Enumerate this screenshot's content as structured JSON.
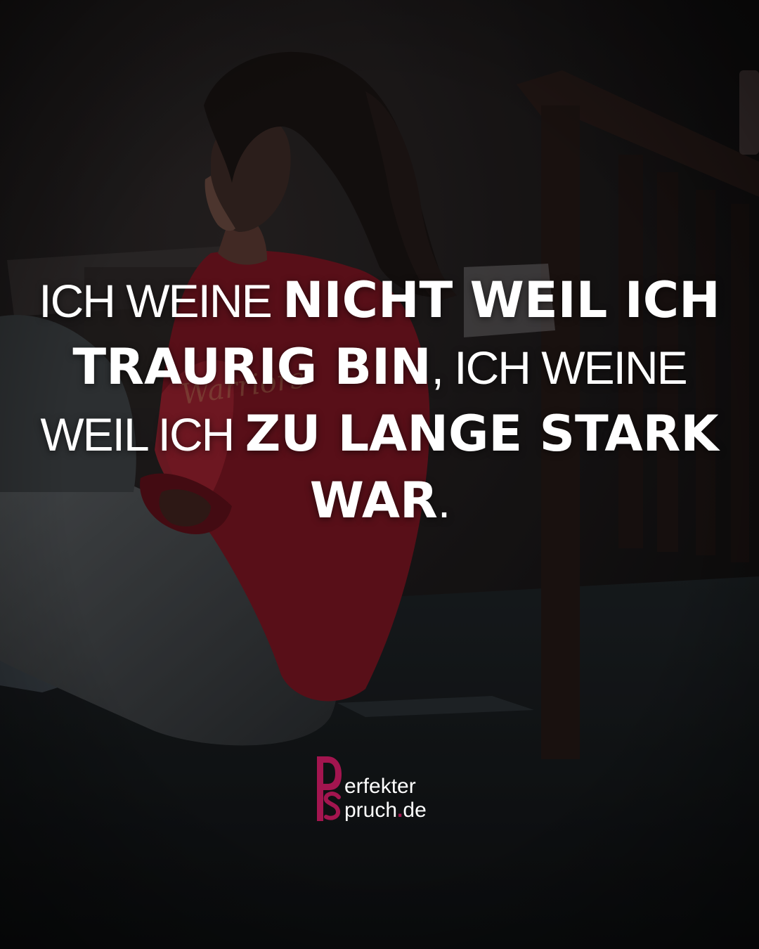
{
  "quote": {
    "line1_thin": "ICH WEINE ",
    "line1_bold": "NICHT WEIL ICH",
    "line2_bold": "TRAURIG BIN",
    "line2_thin": ", ICH WEINE",
    "line3_thin": "WEIL ICH ",
    "line3_bold": "ZU LANGE STARK",
    "line4_bold": "WAR",
    "line4_thin": "."
  },
  "logo": {
    "line1": "erfekter",
    "line2_a": "pruch",
    "line2_dot": ".",
    "line2_b": "de",
    "accent_color": "#a3154f"
  },
  "colors": {
    "text": "#ffffff",
    "hoodie": "#7a1622",
    "background": "#161415"
  }
}
